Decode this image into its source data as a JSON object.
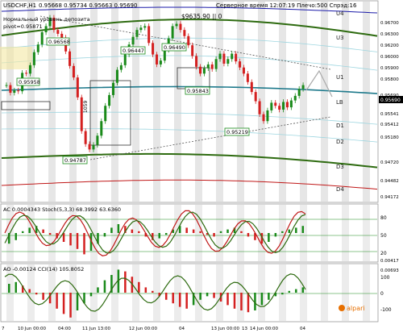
{
  "header": {
    "symbol": "USDCHF,H1",
    "ohlc": "0.95668 0.95734 0.95663 0.95690",
    "line2": "Нормальный уровень депозита",
    "line3": "pivot=0.95871",
    "info": "$9635.90   || 0",
    "server_time": "Серверное время 12:07:19 Плечо:500 Спрэд:16"
  },
  "colors": {
    "bull": "#1a8a1a",
    "bear": "#d42020",
    "resistance": "#2e6b10",
    "support_band": "#2e6b10",
    "pivot": "#1f7a8c",
    "upper_band": "#1a1aa8",
    "lower_band": "#c01818",
    "osc_fast": "#c01818",
    "osc_slow": "#2e6b10"
  },
  "level_labels": {
    "U4": "U4",
    "U3": "U3",
    "U1": "U1",
    "LB": "LB",
    "D1": "D1",
    "D2": "D2",
    "D3": "D3",
    "D4": "D4"
  },
  "price_axis": {
    "labels": [
      "0.96700",
      "0.96300",
      "0.96200",
      "0.96000",
      "0.95900",
      "0.95800",
      "0.95690",
      "0.95541",
      "0.95412",
      "0.95180",
      "0.94720",
      "0.94482",
      "0.94172"
    ],
    "current": "0.95690"
  },
  "annotations": [
    {
      "id": "a1",
      "text": "0.95958"
    },
    {
      "id": "a2",
      "text": "0.96568"
    },
    {
      "id": "a3",
      "text": "0.96447"
    },
    {
      "id": "a4",
      "text": "0.96490"
    },
    {
      "id": "a5",
      "text": "0.95843"
    },
    {
      "id": "a6",
      "text": "0.95219"
    },
    {
      "id": "a7",
      "text": "0.94787"
    },
    {
      "id": "a8",
      "text": "1059"
    }
  ],
  "indicators": {
    "ac": {
      "label": "AC 0.0004343  Stoch(5,3,3) 68.3992 63.6360",
      "axis": [
        "80",
        "50",
        "20"
      ],
      "axis2": "0.00417"
    },
    "ao": {
      "label": "AO -0.00124  CCI(14) 105.8052",
      "axis": [
        "100",
        "0",
        "-100"
      ],
      "axis2": "0.00693"
    }
  },
  "time_axis": [
    "7",
    "10 Jun 00:00",
    "04:00",
    "11 Jun 13:00",
    "12 Jun 00:00",
    "04",
    "13 Jun 00:00",
    "13",
    "14 Jun 00:00",
    "04"
  ],
  "logo": "alpari",
  "chart_data": {
    "type": "candlestick",
    "symbol": "USDCHF",
    "timeframe": "H1",
    "close": [
      0.9569,
      0.9559,
      0.9562,
      0.9561,
      0.9585,
      0.9584,
      0.9595,
      0.9612,
      0.9622,
      0.9638,
      0.9646,
      0.9657,
      0.9641,
      0.9636,
      0.9631,
      0.9613,
      0.9594,
      0.9579,
      0.9553,
      0.9509,
      0.9492,
      0.9485,
      0.9491,
      0.9503,
      0.9522,
      0.9542,
      0.9556,
      0.9572,
      0.9589,
      0.9595,
      0.9609,
      0.9622,
      0.9632,
      0.9641,
      0.9644,
      0.9646,
      0.9624,
      0.9609,
      0.9596,
      0.9601,
      0.9615,
      0.963,
      0.9646,
      0.9649,
      0.9641,
      0.9633,
      0.9621,
      0.9607,
      0.9593,
      0.9584,
      0.9591,
      0.9596,
      0.959,
      0.9603,
      0.961,
      0.9597,
      0.9603,
      0.961,
      0.96,
      0.9592,
      0.9584,
      0.9573,
      0.956,
      0.9548,
      0.9531,
      0.9522,
      0.9536,
      0.9546,
      0.9542,
      0.9537,
      0.9547,
      0.954,
      0.9549,
      0.9555,
      0.9564,
      0.9569
    ],
    "price_range": [
      0.9417,
      0.9678
    ],
    "levels": {
      "U4": 0.9676,
      "U3": 0.9649,
      "U1": 0.9607,
      "LB": 0.9566,
      "D1": 0.9541,
      "D2": 0.9518,
      "D3": 0.9472,
      "D4": 0.9448
    },
    "ac_series": [
      -0.0006,
      -0.0004,
      0.0001,
      0.0003,
      0.0004,
      0.0002,
      -0.0001,
      -0.0003,
      -0.0005,
      -0.0007,
      -0.0009,
      -0.0012,
      -0.001,
      -0.0006,
      -0.0002,
      0.0003,
      0.0005,
      0.0004,
      0.0002,
      0.0001,
      -0.0002,
      -0.0004,
      -0.0003,
      -0.0001,
      0.0002,
      0.0004,
      0.0003,
      0.0002,
      0.0001,
      -0.0001,
      -0.0002,
      0.0001,
      0.0002,
      0.0003,
      0.0001,
      -0.0002,
      -0.0004,
      -0.0006,
      -0.0005,
      -0.0002,
      0.0001,
      0.0002,
      0.0003,
      0.0004
    ],
    "ao_series": [
      0.0005,
      0.0006,
      0.0004,
      0.0002,
      -0.0001,
      -0.0004,
      -0.0006,
      -0.0009,
      -0.0012,
      -0.0014,
      -0.001,
      -0.0006,
      -0.0002,
      0.0003,
      0.0007,
      0.001,
      0.0013,
      0.0012,
      0.0009,
      0.0006,
      0.0003,
      0.0001,
      -0.0002,
      -0.0004,
      -0.0006,
      -0.0008,
      -0.0009,
      -0.0007,
      -0.0004,
      -0.0002,
      -0.0003,
      -0.0005,
      -0.0007,
      -0.0009,
      -0.001,
      -0.0011,
      -0.001,
      -0.0007,
      -0.0004,
      -0.0002,
      -0.0001,
      0.0001,
      0.0002,
      0.0003
    ]
  }
}
